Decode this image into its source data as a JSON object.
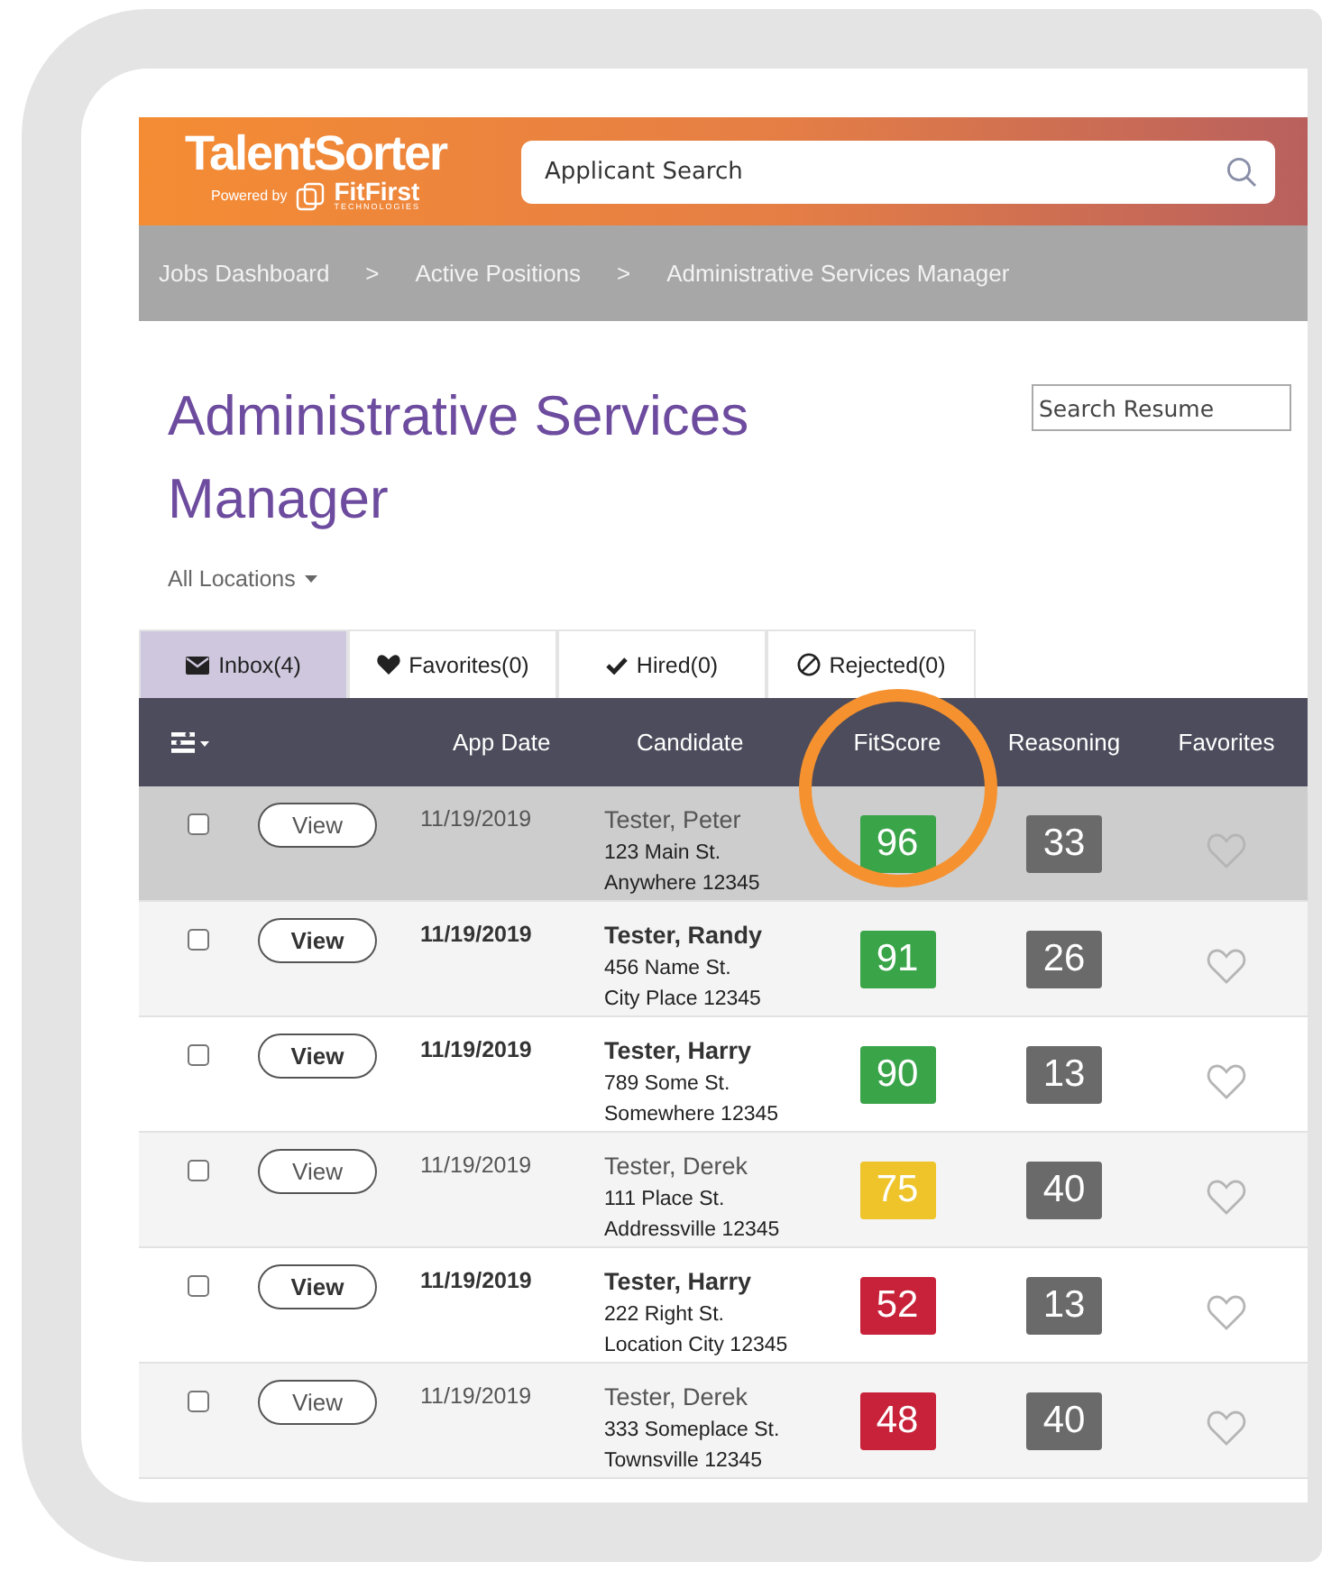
{
  "brand": {
    "name": "TalentSorter",
    "powered_by": "Powered by",
    "partner": "FitFirst",
    "partner_sub": "TECHNOLOGIES"
  },
  "search": {
    "placeholder": "Applicant Search"
  },
  "breadcrumb": [
    "Jobs Dashboard",
    ">",
    "Active Positions",
    ">",
    "Administrative Services Manager"
  ],
  "title": "Administrative Services Manager",
  "resume_search": {
    "placeholder": "Search Resume"
  },
  "location_filter": "All Locations",
  "tabs": [
    {
      "label": "Inbox(4)",
      "kind": "envelope",
      "selected": true
    },
    {
      "label": "Favorites(0)",
      "kind": "heart",
      "selected": false
    },
    {
      "label": "Hired(0)",
      "kind": "check",
      "selected": false
    },
    {
      "label": "Rejected(0)",
      "kind": "ban",
      "selected": false
    }
  ],
  "table": {
    "columns": [
      "App Date",
      "Candidate",
      "FitScore",
      "Reasoning",
      "Favorites"
    ],
    "rows": [
      {
        "highlighted": true,
        "unread": false,
        "button": "View",
        "date": "11/19/2019",
        "name": "Tester, Peter",
        "address": "123 Main St.",
        "city": "Anywhere 12345",
        "fitscore": "96",
        "color": "#3aa449",
        "reasoning": "33"
      },
      {
        "highlighted": false,
        "unread": true,
        "button": "View",
        "date": "11/19/2019",
        "name": "Tester, Randy",
        "address": "456 Name St.",
        "city": "City Place 12345",
        "fitscore": "91",
        "color": "#3aa449",
        "reasoning": "26"
      },
      {
        "highlighted": false,
        "unread": true,
        "button": "View",
        "date": "11/19/2019",
        "name": "Tester, Harry",
        "address": "789 Some St.",
        "city": "Somewhere 12345",
        "fitscore": "90",
        "color": "#3aa449",
        "reasoning": "13"
      },
      {
        "highlighted": false,
        "unread": false,
        "button": "View",
        "date": "11/19/2019",
        "name": "Tester, Derek",
        "address": "111 Place St.",
        "city": "Addressville 12345",
        "fitscore": "75",
        "color": "#eec42a",
        "reasoning": "40"
      },
      {
        "highlighted": false,
        "unread": true,
        "button": "View",
        "date": "11/19/2019",
        "name": "Tester, Harry",
        "address": "222 Right St.",
        "city": "Location City 12345",
        "fitscore": "52",
        "color": "#c8223a",
        "reasoning": "13"
      },
      {
        "highlighted": false,
        "unread": false,
        "button": "View",
        "date": "11/19/2019",
        "name": "Tester, Derek",
        "address": "333 Someplace St.",
        "city": "Townsville 12345",
        "fitscore": "48",
        "color": "#c8223a",
        "reasoning": "40"
      }
    ]
  }
}
